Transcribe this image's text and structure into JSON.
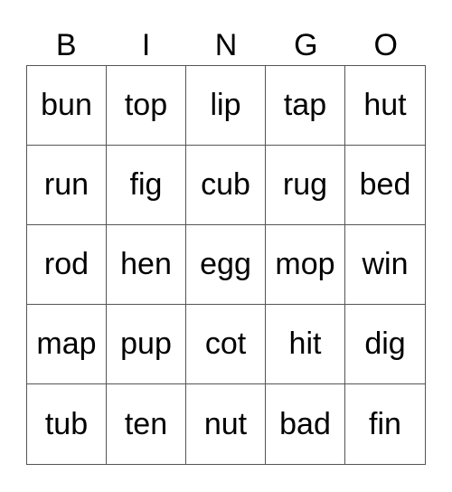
{
  "header": [
    "B",
    "I",
    "N",
    "G",
    "O"
  ],
  "cells": [
    [
      "bun",
      "top",
      "lip",
      "tap",
      "hut"
    ],
    [
      "run",
      "fig",
      "cub",
      "rug",
      "bed"
    ],
    [
      "rod",
      "hen",
      "egg",
      "mop",
      "win"
    ],
    [
      "map",
      "pup",
      "cot",
      "hit",
      "dig"
    ],
    [
      "tub",
      "ten",
      "nut",
      "bad",
      "fin"
    ]
  ]
}
